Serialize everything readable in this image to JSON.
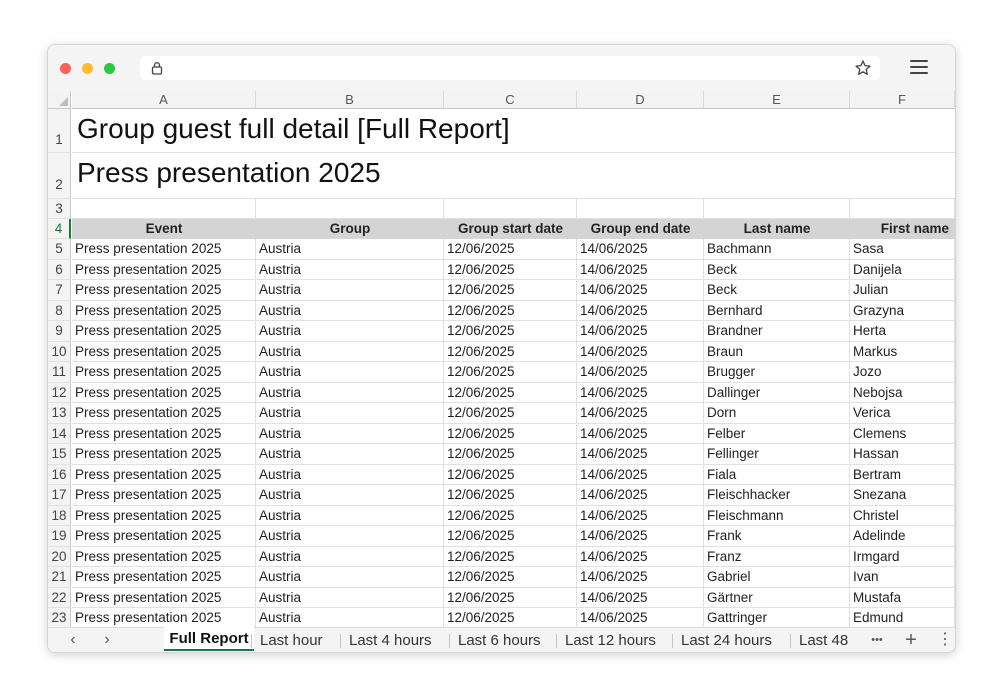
{
  "browser": {
    "url": ""
  },
  "spreadsheet": {
    "columns": [
      "A",
      "B",
      "C",
      "D",
      "E",
      "F"
    ],
    "row_numbers": [
      "1",
      "2",
      "3",
      "4",
      "5",
      "6",
      "7",
      "8",
      "9",
      "10",
      "11",
      "12",
      "13",
      "14",
      "15",
      "16",
      "17",
      "18",
      "19",
      "20",
      "21",
      "22",
      "23"
    ],
    "title_line1": "Group guest full detail [Full Report]",
    "title_line2": "Press presentation 2025",
    "headers": [
      "Event",
      "Group",
      "Group start date",
      "Group end date",
      "Last name",
      "First name"
    ],
    "rows": [
      [
        "Press presentation 2025",
        "Austria",
        "12/06/2025",
        "14/06/2025",
        "Bachmann",
        "Sasa"
      ],
      [
        "Press presentation 2025",
        "Austria",
        "12/06/2025",
        "14/06/2025",
        "Beck",
        "Danijela"
      ],
      [
        "Press presentation 2025",
        "Austria",
        "12/06/2025",
        "14/06/2025",
        "Beck",
        "Julian"
      ],
      [
        "Press presentation 2025",
        "Austria",
        "12/06/2025",
        "14/06/2025",
        "Bernhard",
        "Grazyna"
      ],
      [
        "Press presentation 2025",
        "Austria",
        "12/06/2025",
        "14/06/2025",
        "Brandner",
        "Herta"
      ],
      [
        "Press presentation 2025",
        "Austria",
        "12/06/2025",
        "14/06/2025",
        "Braun",
        "Markus"
      ],
      [
        "Press presentation 2025",
        "Austria",
        "12/06/2025",
        "14/06/2025",
        "Brugger",
        "Jozo"
      ],
      [
        "Press presentation 2025",
        "Austria",
        "12/06/2025",
        "14/06/2025",
        "Dallinger",
        "Nebojsa"
      ],
      [
        "Press presentation 2025",
        "Austria",
        "12/06/2025",
        "14/06/2025",
        "Dorn",
        "Verica"
      ],
      [
        "Press presentation 2025",
        "Austria",
        "12/06/2025",
        "14/06/2025",
        "Felber",
        "Clemens"
      ],
      [
        "Press presentation 2025",
        "Austria",
        "12/06/2025",
        "14/06/2025",
        "Fellinger",
        "Hassan"
      ],
      [
        "Press presentation 2025",
        "Austria",
        "12/06/2025",
        "14/06/2025",
        "Fiala",
        "Bertram"
      ],
      [
        "Press presentation 2025",
        "Austria",
        "12/06/2025",
        "14/06/2025",
        "Fleischhacker",
        "Snezana"
      ],
      [
        "Press presentation 2025",
        "Austria",
        "12/06/2025",
        "14/06/2025",
        "Fleischmann",
        "Christel"
      ],
      [
        "Press presentation 2025",
        "Austria",
        "12/06/2025",
        "14/06/2025",
        "Frank",
        "Adelinde"
      ],
      [
        "Press presentation 2025",
        "Austria",
        "12/06/2025",
        "14/06/2025",
        "Franz",
        "Irmgard"
      ],
      [
        "Press presentation 2025",
        "Austria",
        "12/06/2025",
        "14/06/2025",
        "Gabriel",
        "Ivan"
      ],
      [
        "Press presentation 2025",
        "Austria",
        "12/06/2025",
        "14/06/2025",
        "Gärtner",
        "Mustafa"
      ],
      [
        "Press presentation 2025",
        "Austria",
        "12/06/2025",
        "14/06/2025",
        "Gattringer",
        "Edmund"
      ]
    ],
    "active_row": "4"
  },
  "sheet_tabs": {
    "prev_label": "‹",
    "next_label": "›",
    "tabs": [
      "Full Report",
      "Last hour",
      "Last 4 hours",
      "Last 6 hours",
      "Last 12 hours",
      "Last 24 hours",
      "Last 48"
    ],
    "more_label": "•••",
    "add_label": "+",
    "options_label": "⋮"
  },
  "colors": {
    "accent": "#107c41",
    "header_fill": "#d4d4d4"
  }
}
